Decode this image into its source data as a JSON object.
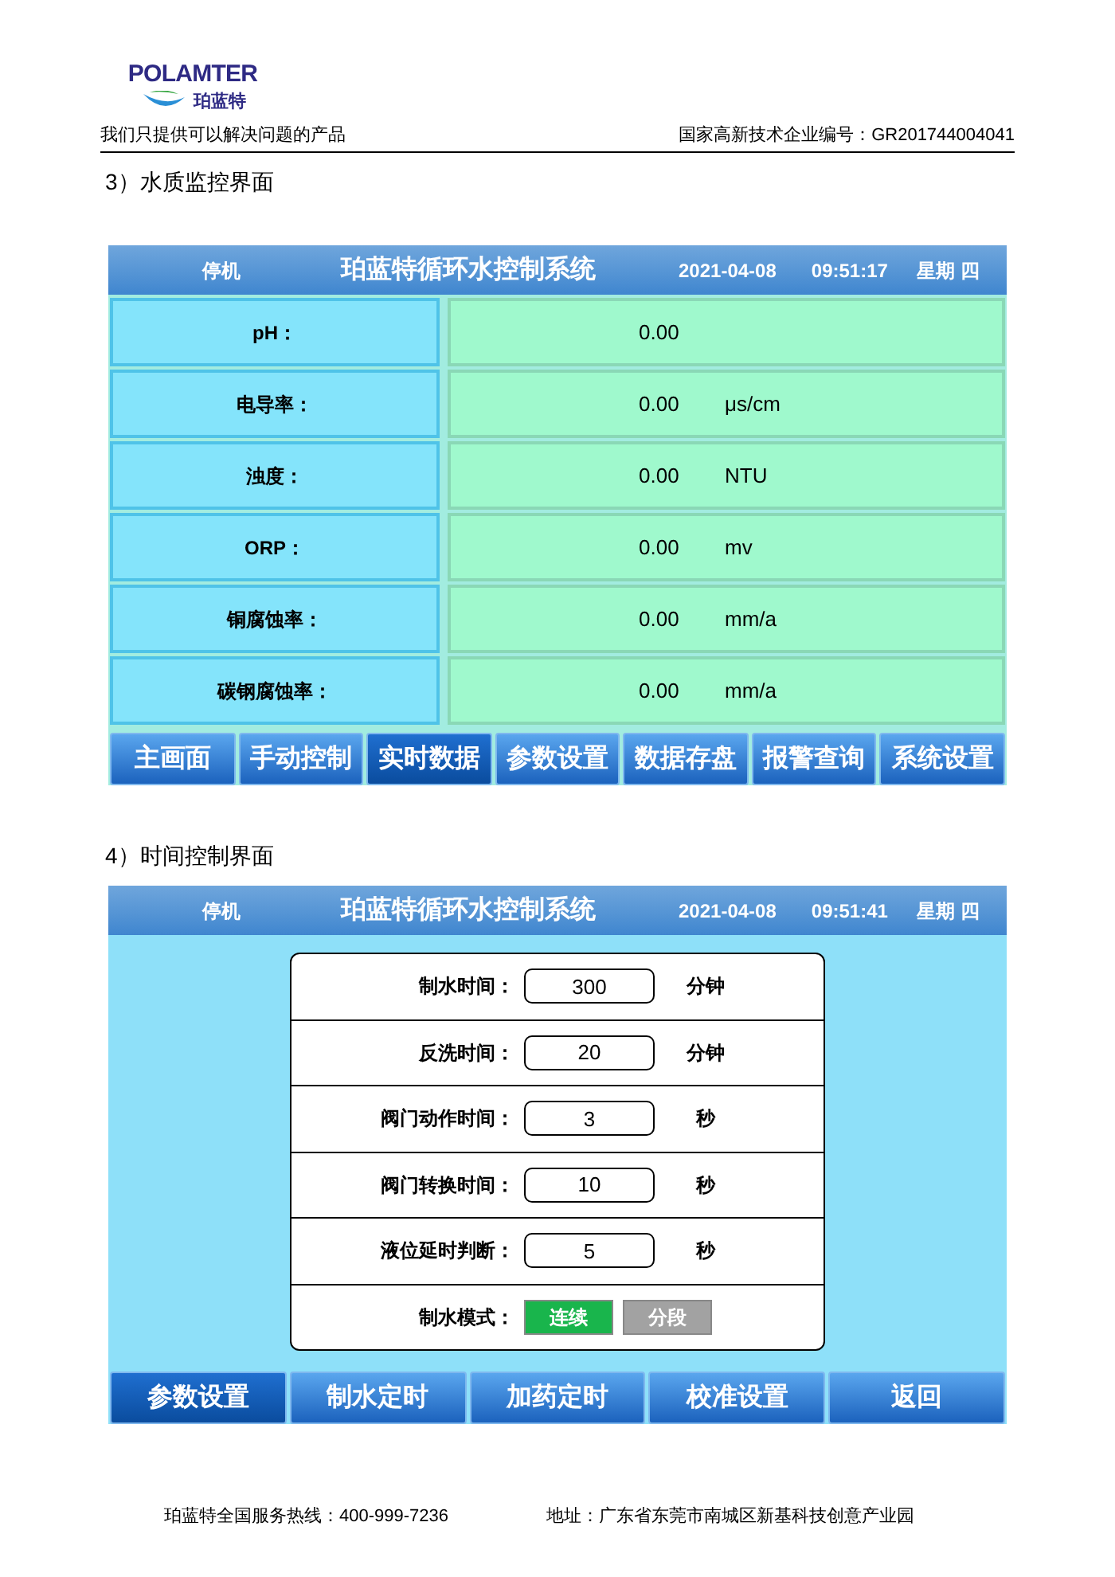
{
  "header": {
    "logo_latin": "POLAMTER",
    "logo_chinese": "珀蓝特",
    "slogan": "我们只提供可以解决问题的产品",
    "cert": "国家高新技术企业编号：GR201744004041"
  },
  "monitor_title": "3）水质监控界面",
  "monitor_screen": {
    "status": "停机",
    "title": "珀蓝特循环水控制系统",
    "date": "2021-04-08",
    "time": "09:51:17",
    "weekday": "星期 四",
    "readings": [
      {
        "label": "pH：",
        "value": "0.00"
      },
      {
        "label": "电导率：",
        "value": "0.00",
        "unit": "μs/cm"
      },
      {
        "label": "浊度：",
        "value": "0.00",
        "unit": "NTU"
      },
      {
        "label": "ORP：",
        "value": "0.00",
        "unit": "mv"
      },
      {
        "label": "铜腐蚀率：",
        "value": "0.00",
        "unit": "mm/a"
      },
      {
        "label": "碳钢腐蚀率：",
        "value": "0.00",
        "unit": "mm/a"
      }
    ],
    "tabs": [
      {
        "label": "主画面",
        "selected": false
      },
      {
        "label": "手动控制",
        "selected": false
      },
      {
        "label": "实时数据",
        "selected": true
      },
      {
        "label": "参数设置",
        "selected": false
      },
      {
        "label": "数据存盘",
        "selected": false
      },
      {
        "label": "报警查询",
        "selected": false
      },
      {
        "label": "系统设置",
        "selected": false
      }
    ]
  },
  "timer_title": "4）时间控制界面",
  "timer_screen": {
    "status": "停机",
    "title": "珀蓝特循环水控制系统",
    "date": "2021-04-08",
    "time": "09:51:41",
    "weekday": "星期 四",
    "settings": [
      {
        "kind": "field",
        "label": "制水时间：",
        "value": "300",
        "unit": "分钟"
      },
      {
        "kind": "field",
        "label": "反洗时间：",
        "value": "20",
        "unit": "分钟"
      },
      {
        "kind": "field",
        "label": "阀门动作时间：",
        "value": "3",
        "unit": "秒"
      },
      {
        "kind": "field",
        "label": "阀门转换时间：",
        "value": "10",
        "unit": "秒"
      },
      {
        "kind": "field",
        "label": "液位延时判断：",
        "value": "5",
        "unit": "秒"
      },
      {
        "kind": "mode",
        "label": "制水模式：",
        "options": [
          {
            "label": "连续",
            "selected": true
          },
          {
            "label": "分段",
            "selected": false
          }
        ]
      }
    ],
    "tabs": [
      {
        "label": "参数设置",
        "selected": true
      },
      {
        "label": "制水定时",
        "selected": false
      },
      {
        "label": "加药定时",
        "selected": false
      },
      {
        "label": "校准设置",
        "selected": false
      },
      {
        "label": "返回",
        "selected": false
      }
    ]
  },
  "footer": {
    "hotline": "珀蓝特全国服务热线：400-999-7236",
    "address": "地址：广东省东莞市南城区新基科技创意产业园"
  }
}
